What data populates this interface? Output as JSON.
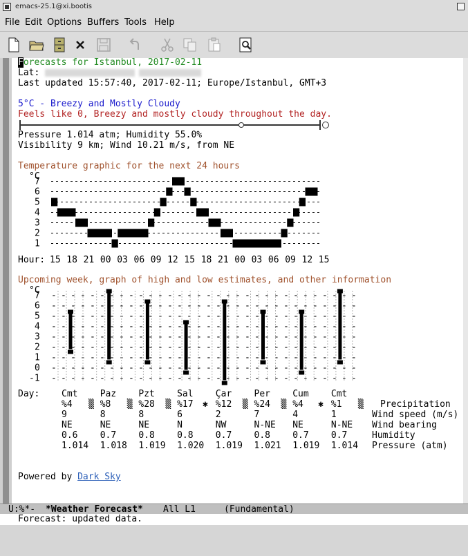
{
  "window": {
    "title": "emacs-25.1@xi.bootis"
  },
  "menu": [
    "File",
    "Edit",
    "Options",
    "Buffers",
    "Tools",
    "Help"
  ],
  "toolbar": [
    {
      "name": "new-file",
      "icon": "new-file-icon",
      "enabled": true
    },
    {
      "name": "open-directory",
      "icon": "folder-icon",
      "enabled": true
    },
    {
      "name": "dired",
      "icon": "cabinet-icon",
      "enabled": true
    },
    {
      "name": "kill-buffer",
      "icon": "close-icon",
      "enabled": true
    },
    {
      "name": "save",
      "icon": "save-icon",
      "enabled": false
    },
    {
      "name": "undo",
      "icon": "undo-icon",
      "enabled": false
    },
    {
      "name": "cut",
      "icon": "scissors-icon",
      "enabled": false
    },
    {
      "name": "copy",
      "icon": "copy-icon",
      "enabled": false
    },
    {
      "name": "paste",
      "icon": "paste-icon",
      "enabled": false
    },
    {
      "name": "search",
      "icon": "search-icon",
      "enabled": true
    }
  ],
  "forecast": {
    "heading_first": "F",
    "heading_rest": "orecasts for Istanbul, 2017-02-11",
    "lat_label": "Lat:",
    "last_updated": "Last updated 15:57:40, 2017-02-11; Europe/Istanbul, GMT+3",
    "summary": "5°C - Breezy and Mostly Cloudy",
    "feels_like": "Feels like 0, Breezy and mostly cloudy throughout the day.",
    "pressure_humidity": "Pressure 1.014 atm; Humidity 55.0%",
    "visibility_wind": "Visibility 9 km; Wind 10.21 m/s, from NE",
    "temp_heading": "Temperature graphic for the next 24 hours",
    "week_heading": "Upcoming week, graph of high and low estimates, and other information",
    "powered_by": "Powered by ",
    "powered_link": "Dark Sky"
  },
  "hourly": {
    "unit": "°C",
    "row_label": "Hour:",
    "y_ticks": [
      "7",
      "6",
      "5",
      "4",
      "3",
      "2",
      "1"
    ],
    "hours": [
      "15",
      "18",
      "21",
      "00",
      "03",
      "06",
      "09",
      "12",
      "15",
      "18",
      "21",
      "00",
      "03",
      "06",
      "09",
      "12",
      "15"
    ],
    "temps": [
      5,
      4,
      4,
      4,
      3,
      3,
      2,
      2,
      2,
      2,
      1,
      2,
      2,
      2,
      2,
      2,
      3,
      4,
      5,
      6,
      7,
      7,
      6,
      5,
      4,
      4,
      3,
      3,
      2,
      2,
      1,
      1,
      1,
      1,
      1,
      1,
      1,
      1,
      2,
      3,
      4,
      5,
      6,
      6
    ]
  },
  "weekly": {
    "unit": "°C",
    "day_label": "Day:",
    "y_ticks": [
      "7",
      "6",
      "5",
      "4",
      "3",
      "2",
      "1",
      "0",
      "-1"
    ],
    "days": [
      "Cmt",
      "Paz",
      "Pzt",
      "Sal",
      "Çar",
      "Per",
      "Cum",
      "Cmt"
    ],
    "highs": [
      5,
      7,
      6,
      4,
      6,
      5,
      5,
      7
    ],
    "lows": [
      2,
      1,
      1,
      0,
      -1,
      1,
      0,
      1
    ],
    "precip": [
      "%4",
      "%8",
      "%28",
      "%17",
      "%12",
      "%24",
      "%4",
      "%1"
    ],
    "precip_icons": [
      "",
      "",
      "",
      "snow",
      "",
      "",
      "snow",
      ""
    ],
    "wind_speed": [
      "9",
      "8",
      "8",
      "6",
      "2",
      "7",
      "4",
      "1"
    ],
    "wind_bearing": [
      "NE",
      "NE",
      "NE",
      "N",
      "NW",
      "N-NE",
      "NE",
      "N-NE"
    ],
    "humidity": [
      "0.6",
      "0.7",
      "0.8",
      "0.8",
      "0.7",
      "0.8",
      "0.7",
      "0.7"
    ],
    "pressure": [
      "1.014",
      "1.018",
      "1.019",
      "1.020",
      "1.019",
      "1.021",
      "1.019",
      "1.014"
    ],
    "row_labels": [
      "Precipitation",
      "Wind speed (m/s)",
      "Wind bearing",
      "Humidity",
      "Pressure (atm)"
    ]
  },
  "modeline": {
    "status": "U:%*-",
    "buffer": "*Weather Forecast*",
    "position": "All L1",
    "mode": "(Fundamental)"
  },
  "minibuffer": "Forecast: updated data."
}
